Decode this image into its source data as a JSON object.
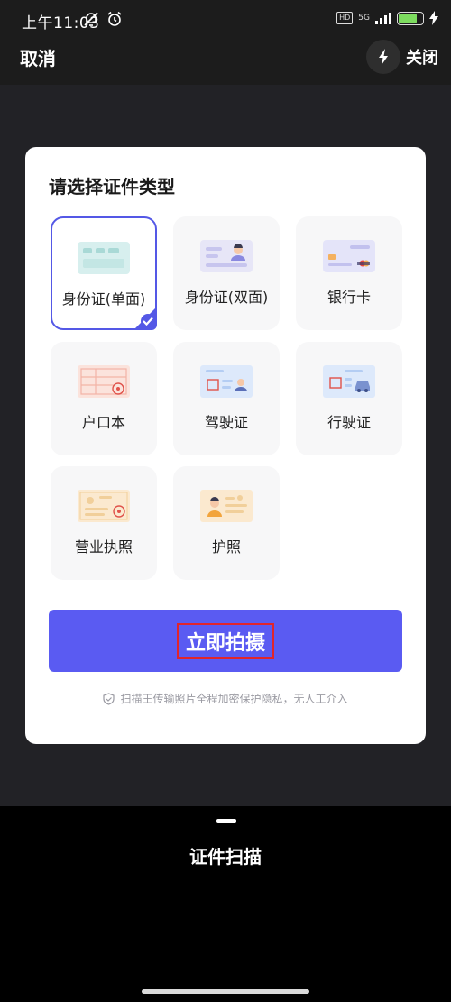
{
  "status_bar": {
    "time": "上午11:03",
    "network_type": "5G",
    "hd_badge": "HD",
    "battery_percent": 75
  },
  "top_bar": {
    "cancel_label": "取消",
    "close_label": "关闭"
  },
  "card": {
    "title": "请选择证件类型",
    "tiles": [
      {
        "label": "身份证(单面)",
        "icon": "id-card-single-icon",
        "selected": true
      },
      {
        "label": "身份证(双面)",
        "icon": "id-card-double-icon",
        "selected": false
      },
      {
        "label": "银行卡",
        "icon": "bank-card-icon",
        "selected": false
      },
      {
        "label": "户口本",
        "icon": "household-register-icon",
        "selected": false
      },
      {
        "label": "驾驶证",
        "icon": "driver-license-icon",
        "selected": false
      },
      {
        "label": "行驶证",
        "icon": "vehicle-license-icon",
        "selected": false
      },
      {
        "label": "营业执照",
        "icon": "business-license-icon",
        "selected": false
      },
      {
        "label": "护照",
        "icon": "passport-icon",
        "selected": false
      }
    ],
    "shoot_label": "立即拍摄",
    "privacy_text": "扫描王传输照片全程加密保护隐私，无人工介入"
  },
  "bottom": {
    "mode_label": "证件扫描"
  },
  "colors": {
    "accent": "#5a5bf2",
    "selected_border": "#5458e6",
    "highlight_box": "#e0252b"
  }
}
